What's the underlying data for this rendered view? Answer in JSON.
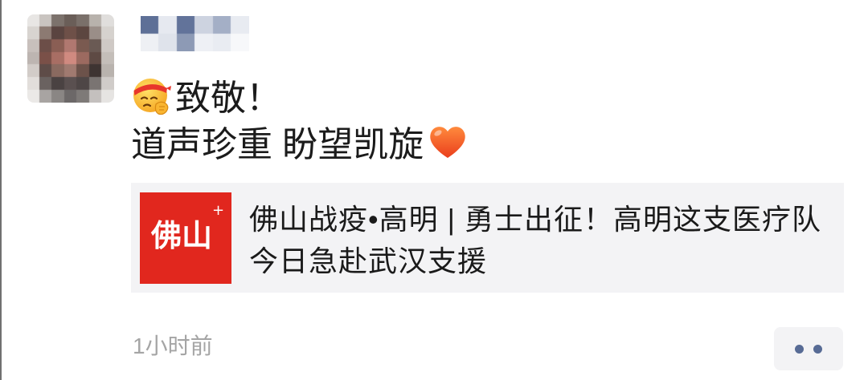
{
  "post": {
    "lines": [
      {
        "emoji": "salute-face",
        "text": "致敬！"
      },
      {
        "text": "道声珍重 盼望凯旋",
        "emoji": "orange-heart"
      }
    ],
    "link_card": {
      "thumbnail": {
        "logo_text": "佛山",
        "logo_mark": "+"
      },
      "title": "佛山战疫•高明 | 勇士出征！高明这支医疗队今日急赴武汉支援"
    },
    "timestamp": "1小时前",
    "more_button": {
      "icon": "two-dots-icon"
    }
  },
  "colors": {
    "thumbnail_red": "#e1271e",
    "card_background": "#f3f3f5",
    "link_blue": "#576b95",
    "timestamp_gray": "#a5a5a5"
  }
}
